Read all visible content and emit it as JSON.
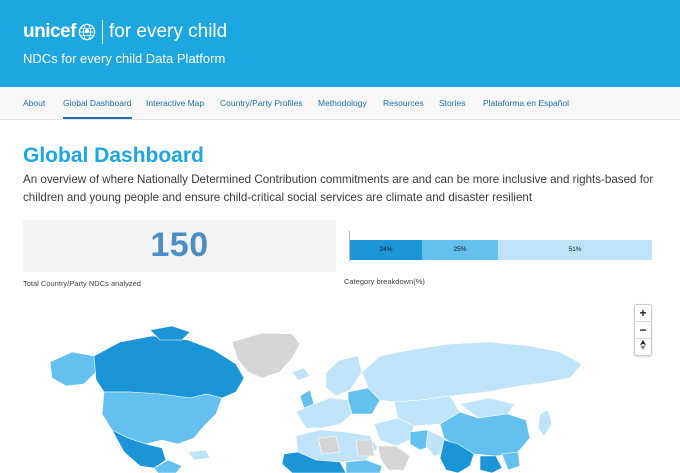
{
  "header": {
    "logo_word": "unicef",
    "logo_tagline": "for every child",
    "platform_title": "NDCs for every child Data Platform",
    "color": "#1ca7e1"
  },
  "nav": {
    "items": [
      {
        "label": "About",
        "active": false
      },
      {
        "label": "Global Dashboard",
        "active": true
      },
      {
        "label": "Interactive Map",
        "active": false
      },
      {
        "label": "Country/Party Profiles",
        "active": false
      },
      {
        "label": "Methodology",
        "active": false
      },
      {
        "label": "Resources",
        "active": false
      },
      {
        "label": "Stories",
        "active": false
      },
      {
        "label": "Plataforma en Español",
        "active": false
      }
    ]
  },
  "main": {
    "title": "Global Dashboard",
    "description": "An overview of where Nationally Determined Contribution commitments are and can be more inclusive and rights-based for children and young people and ensure child-critical social services are climate and disaster resilient"
  },
  "stat": {
    "value": "150",
    "label": "Total Country/Party NDCs analyzed"
  },
  "breakdown": {
    "label": "Category breakdown(%)",
    "segments": [
      {
        "label": "24%",
        "value": 24,
        "color": "#1c95d8"
      },
      {
        "label": "25%",
        "value": 25,
        "color": "#63c0ef"
      },
      {
        "label": "51%",
        "value": 51,
        "color": "#bfe3f8"
      }
    ]
  },
  "map": {
    "controls": {
      "zoom_in": "+",
      "zoom_out": "−",
      "reset_icon": "compass-reset-icon"
    },
    "colors": {
      "dark": "#1c95d8",
      "medium": "#63c0ef",
      "light": "#bfe3f8",
      "no_data": "#d6d6d6"
    }
  }
}
